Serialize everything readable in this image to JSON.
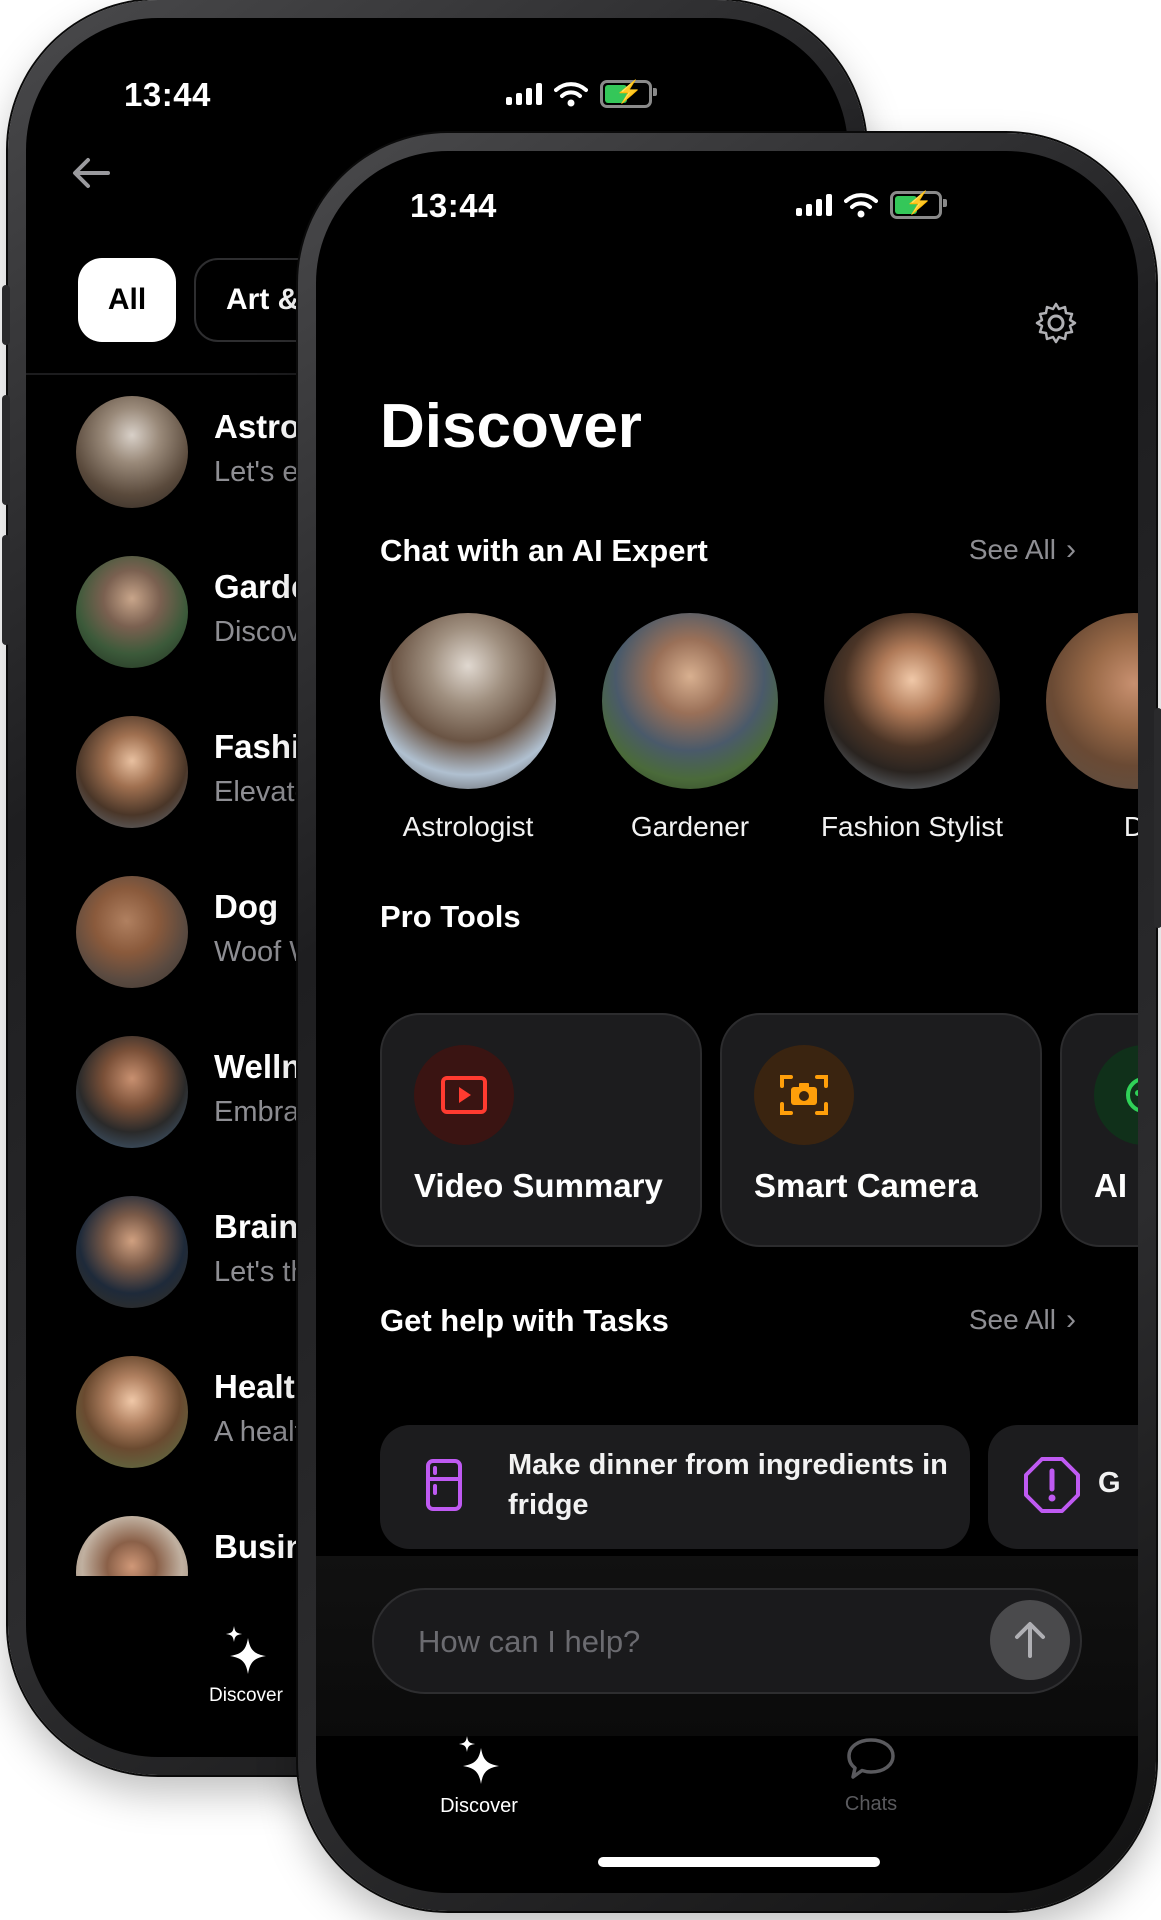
{
  "back_screen": {
    "status_time": "13:44",
    "filters": [
      "All",
      "Art &"
    ],
    "experts": [
      {
        "name": "Astrol",
        "sub": "Let's ex"
      },
      {
        "name": "Garde",
        "sub": "Discov"
      },
      {
        "name": "Fashio",
        "sub": "Elevate"
      },
      {
        "name": "Dog",
        "sub": "Woof W"
      },
      {
        "name": "Wellne",
        "sub": "Embrac"
      },
      {
        "name": "Brains",
        "sub": "Let's th"
      },
      {
        "name": "Health",
        "sub": "A healt"
      },
      {
        "name": "Busine",
        "sub": ""
      }
    ],
    "tab_label": "Discover"
  },
  "front_screen": {
    "status_time": "13:44",
    "title": "Discover",
    "experts_section": {
      "title": "Chat with an AI Expert",
      "see_all": "See All",
      "items": [
        {
          "label": "Astrologist"
        },
        {
          "label": "Gardener"
        },
        {
          "label": "Fashion Stylist"
        },
        {
          "label": "D"
        }
      ]
    },
    "tools_section": {
      "title": "Pro Tools",
      "items": [
        {
          "label": "Video Summary",
          "icon": "video-play-icon",
          "color": "#ff3b30"
        },
        {
          "label": "Smart Camera",
          "icon": "camera-icon",
          "color": "#ff9f0a"
        },
        {
          "label": "AI",
          "icon": "ai-icon",
          "color": "#30d158"
        }
      ]
    },
    "tasks_section": {
      "title": "Get help with Tasks",
      "see_all": "See All",
      "items": [
        {
          "label": "Make dinner from ingredients in fridge",
          "icon": "fridge-icon",
          "color": "#bf5af2"
        },
        {
          "label": "G",
          "icon": "alert-icon",
          "color": "#bf5af2"
        }
      ]
    },
    "composer": {
      "placeholder": "How can I help?"
    },
    "tabs": [
      {
        "label": "Discover",
        "icon": "sparkle-icon",
        "active": true
      },
      {
        "label": "Chats",
        "icon": "chat-bubble-icon",
        "active": false
      }
    ]
  }
}
